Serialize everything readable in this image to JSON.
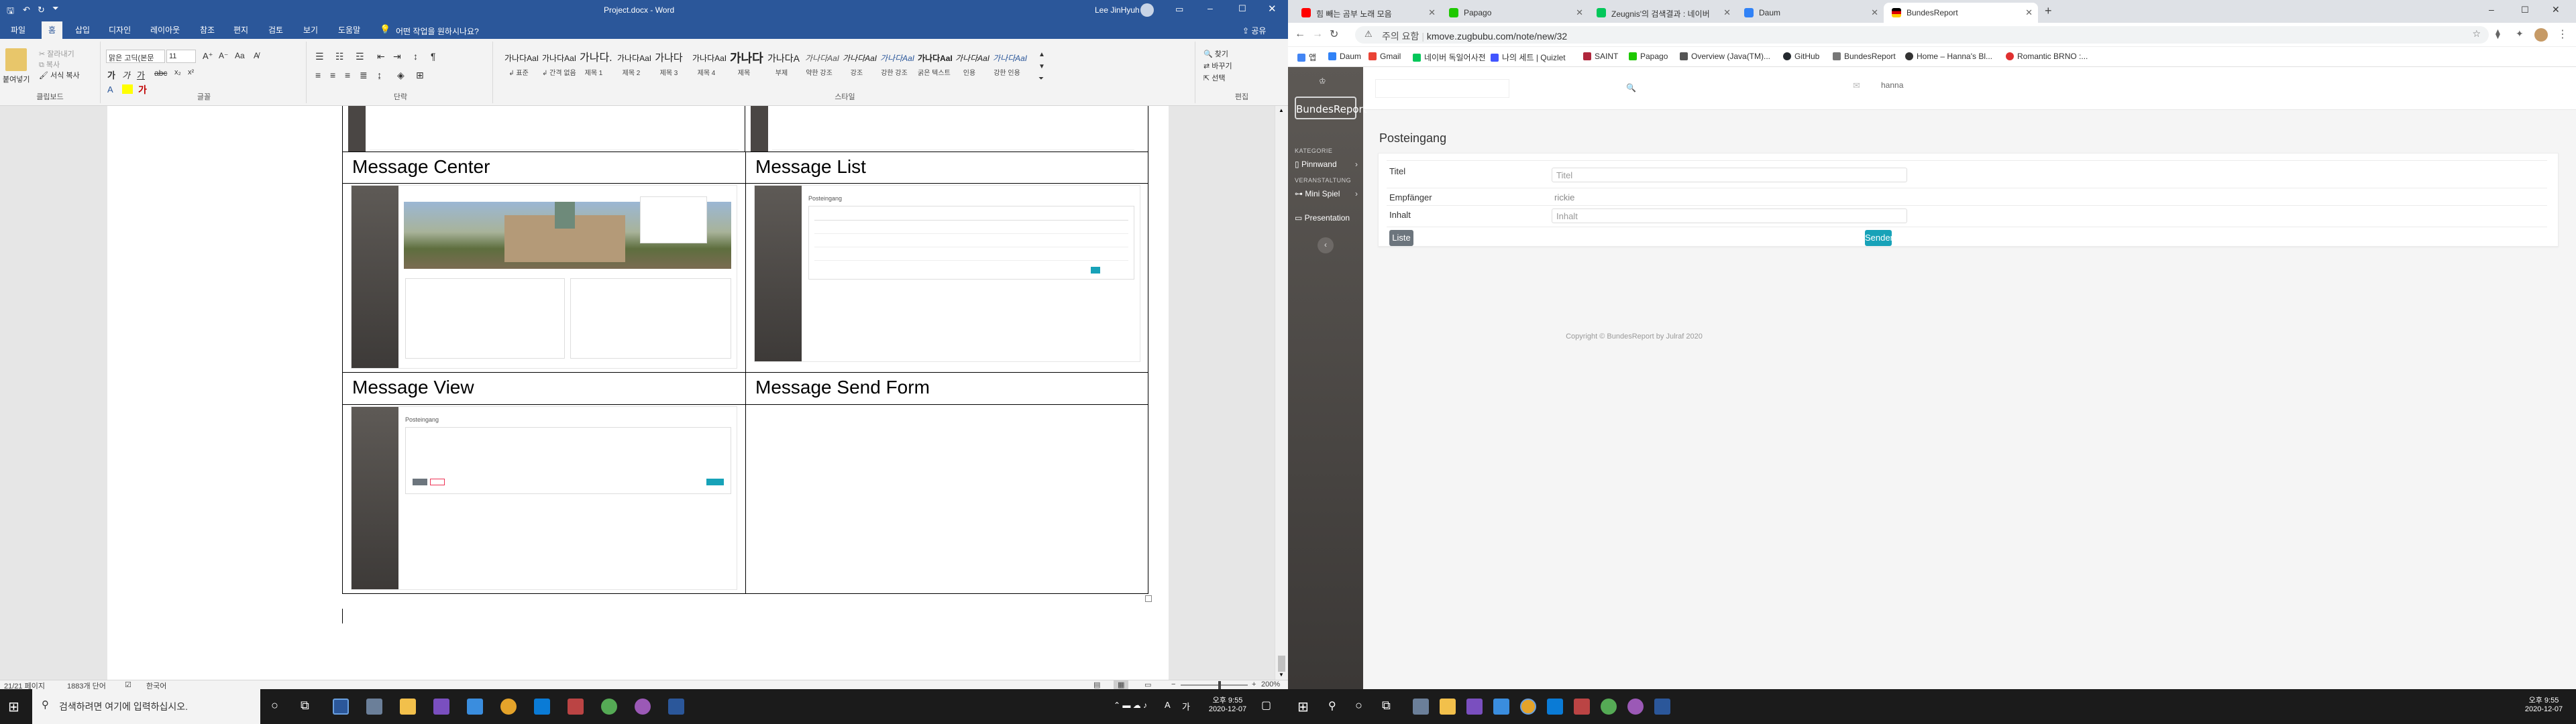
{
  "word": {
    "qat_icons": [
      "save-icon",
      "undo-icon",
      "redo-icon",
      "customize-icon"
    ],
    "title": "Project.docx  -  Word",
    "user": "Lee JinHyuh",
    "window_controls": [
      "ribbon-display-icon",
      "minimize-icon",
      "maximize-icon",
      "close-icon"
    ],
    "tabs": [
      "파일",
      "홈",
      "삽입",
      "디자인",
      "레이아웃",
      "참조",
      "편지",
      "검토",
      "보기",
      "도움말"
    ],
    "active_tab": "홈",
    "tell_me": "어떤 작업을 원하시나요?",
    "share": "공유",
    "clipboard": {
      "paste": "붙여넣기",
      "cut": "잘라내기",
      "copy": "복사",
      "format_painter": "서식 복사",
      "label": "클립보드"
    },
    "font": {
      "name": "맑은 고딕(본문",
      "size": "11",
      "label": "글꼴"
    },
    "paragraph_label": "단락",
    "styles": {
      "label": "스타일",
      "items": [
        {
          "sample": "가나다AaI",
          "name": "↲ 표준"
        },
        {
          "sample": "가나다AaI",
          "name": "↲ 간격 없음"
        },
        {
          "sample": "가나다.",
          "name": "제목 1"
        },
        {
          "sample": "가나다AaI",
          "name": "제목 2"
        },
        {
          "sample": "가나다",
          "name": "제목 3"
        },
        {
          "sample": "가나다AaI",
          "name": "제목 4"
        },
        {
          "sample": "가나다",
          "name": "제목"
        },
        {
          "sample": "가나다A",
          "name": "부제"
        },
        {
          "sample": "가나다AaI",
          "name": "약한 강조"
        },
        {
          "sample": "가나다AaI",
          "name": "강조"
        },
        {
          "sample": "가나다AaI",
          "name": "강한 강조"
        },
        {
          "sample": "가나다AaI",
          "name": "굵은 텍스트"
        },
        {
          "sample": "가나다AaI",
          "name": "인용"
        },
        {
          "sample": "가나다AaI",
          "name": "강한 인용"
        }
      ]
    },
    "editing": {
      "find": "찾기",
      "replace": "바꾸기",
      "select": "선택",
      "label": "편집"
    },
    "table": [
      {
        "left": "Message Center",
        "right": "Message List"
      },
      {
        "left": "Message View",
        "right": "Message Send Form"
      }
    ],
    "thumb_text": {
      "inbox": "Posteingang"
    },
    "status": {
      "page": "21/21 페이지",
      "words": "1883개 단어",
      "lang": "한국어",
      "zoom": "200%"
    }
  },
  "taskbar_left": {
    "search_placeholder": "검색하려면 여기에 입력하십시오.",
    "time": "오후 9:55",
    "date": "2020-12-07",
    "ime": "A"
  },
  "taskbar_right": {
    "time": "오후 9:55",
    "date": "2020-12-07"
  },
  "chrome": {
    "tabs": [
      {
        "title": "힘 빼는 곰부 노래 모음",
        "fav_color": "#ff0000"
      },
      {
        "title": "Papago",
        "fav_color": "#1ec800"
      },
      {
        "title": "Zeugnis'의 검색결과 : 네이버",
        "fav_color": "#03c75a"
      },
      {
        "title": "Daum",
        "fav_color": "#3182f6"
      },
      {
        "title": "BundesReport",
        "fav_color": "#dd0000"
      }
    ],
    "new_tab": "+",
    "active_tab_index": 4,
    "security_label": "주의 요함",
    "url": "kmove.zugbubu.com/note/new/32",
    "bookmarks": [
      {
        "label": "앱",
        "color": "#4285f4"
      },
      {
        "label": "Daum",
        "color": "#3182f6"
      },
      {
        "label": "Gmail",
        "color": "#ea4335"
      },
      {
        "label": "네이버 독일어사전",
        "color": "#03c75a"
      },
      {
        "label": "나의 세트 | Quizlet",
        "color": "#4255ff"
      },
      {
        "label": "SAINT",
        "color": "#b0263c"
      },
      {
        "label": "Papago",
        "color": "#1ec800"
      },
      {
        "label": "Overview (Java(TM)...",
        "color": "#555555"
      },
      {
        "label": "GitHub",
        "color": "#24292e"
      },
      {
        "label": "BundesReport",
        "color": "#777777"
      },
      {
        "label": "Home – Hanna's Bl...",
        "color": "#333333"
      },
      {
        "label": "Romantic BRNO :...",
        "color": "#e03030"
      }
    ]
  },
  "app": {
    "logo": "BundesReport",
    "search_placeholder": "",
    "user": "hanna",
    "sidebar": {
      "sections": [
        {
          "category": "KATEGORIE",
          "items": [
            {
              "label": "Pinnwand",
              "icon": "board-icon"
            }
          ]
        },
        {
          "category": "VERANSTALTUNG",
          "items": [
            {
              "label": "Mini Spiel",
              "icon": "gamepad-icon"
            }
          ]
        },
        {
          "category": "",
          "items": [
            {
              "label": "Presentation",
              "icon": "presentation-icon"
            }
          ]
        }
      ]
    },
    "page_title": "Posteingang",
    "form": {
      "title_label": "Titel",
      "title_placeholder": "Titel",
      "recipient_label": "Empfänger",
      "recipient_value": "rickie",
      "content_label": "Inhalt",
      "content_placeholder": "Inhalt"
    },
    "list_button": "Liste",
    "send_button": "Senden",
    "footer": "Copyright © BundesReport by Julraf 2020",
    "colors": {
      "list_btn": "#6c757d",
      "send_btn": "#17a2b8",
      "sidebar_top": "#5d5955",
      "sidebar_bottom": "#3b3836"
    }
  }
}
